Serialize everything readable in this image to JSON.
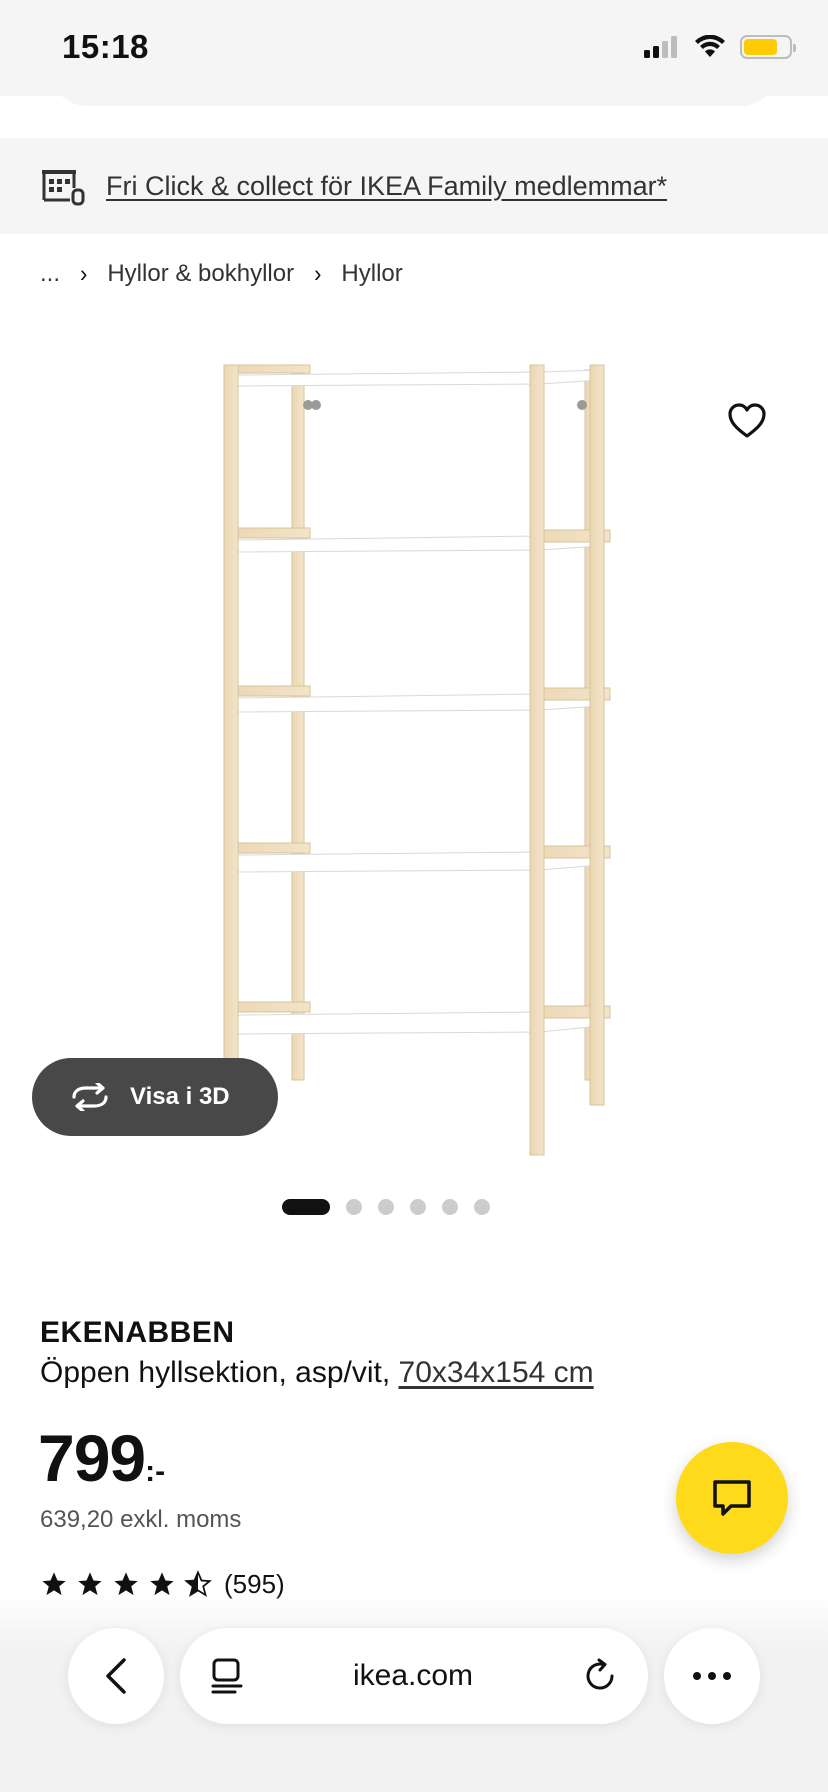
{
  "status_bar": {
    "time": "15:18"
  },
  "promo": {
    "text": "Fri Click & collect för IKEA Family medlemmar*",
    "icon": "store-icon"
  },
  "breadcrumb": {
    "items": [
      "...",
      "Hyllor & bokhyllor",
      "Hyllor"
    ],
    "separator": "›"
  },
  "gallery": {
    "view_3d_label": "Visa i 3D",
    "image_count": 6,
    "active_index": 0
  },
  "product": {
    "name": "EKENABBEN",
    "description": "Öppen hyllsektion, asp/vit,",
    "dimensions": "70x34x154 cm",
    "price": "799",
    "price_suffix": ":-",
    "price_ex_vat": "639,20 exkl. moms",
    "rating_value": 4.5,
    "review_count": "(595)"
  },
  "browser": {
    "url": "ikea.com",
    "back_icon": "chevron-left-icon",
    "tabs_icon": "reader-icon",
    "reload_icon": "reload-icon",
    "more_icon": "more-icon"
  },
  "colors": {
    "accent_yellow": "#ffda1a",
    "battery_yellow": "#ffcb05",
    "pill_dark": "#484848",
    "banner_bg": "#f5f5f5"
  }
}
